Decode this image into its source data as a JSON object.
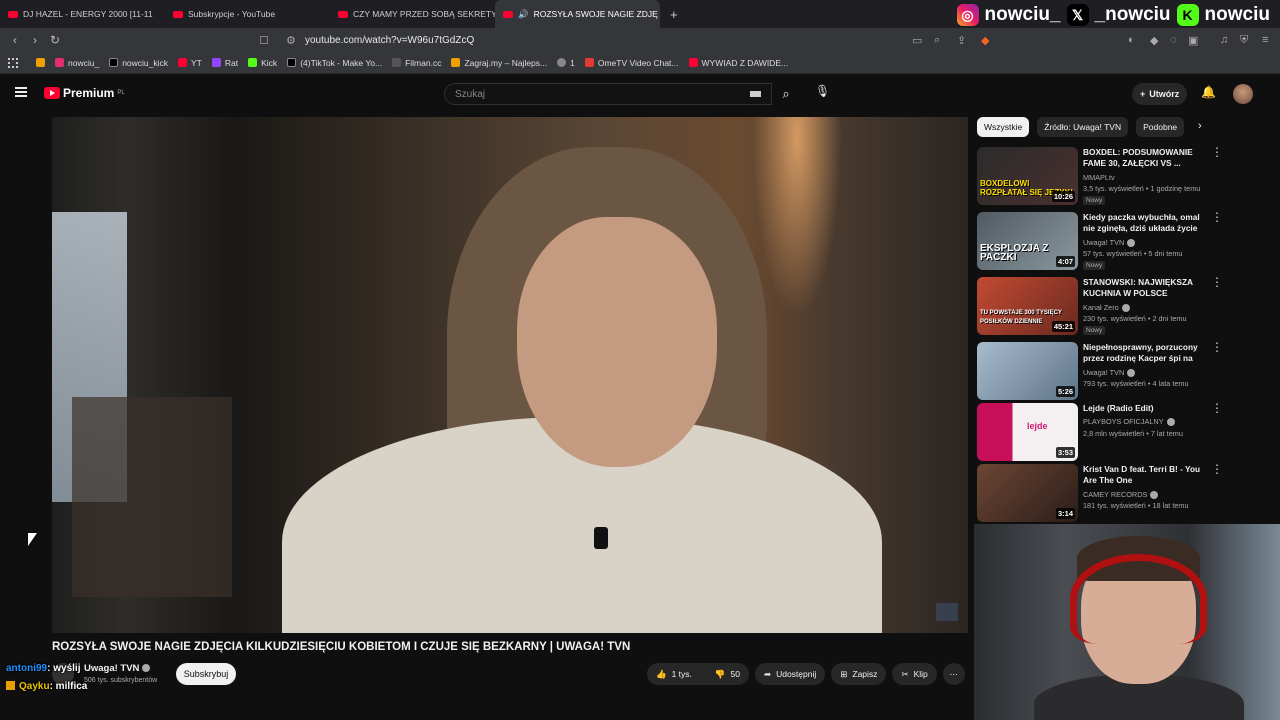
{
  "browser": {
    "tabs": [
      {
        "title": "DJ HAZEL - ENERGY 2000 [11-11"
      },
      {
        "title": "Subskrypcje - YouTube"
      },
      {
        "title": "CZY MAMY PRZED SOBĄ SEKRETY?"
      },
      {
        "title": "ROZSYŁA SWOJE NAGIE ZDJĘ",
        "active": true
      }
    ],
    "url": "youtube.com/watch?v=W96u7tGdZcQ",
    "bookmarks": [
      {
        "label": "nowciu_",
        "color": "#e1306c"
      },
      {
        "label": "nowciu_kick",
        "color": "#000000"
      },
      {
        "label": "YT",
        "color": "#ff0033"
      },
      {
        "label": "Rat",
        "color": "#9146ff"
      },
      {
        "label": "Kick",
        "color": "#53fc18"
      },
      {
        "label": "(4)TikTok - Make Yo...",
        "color": "#000000"
      },
      {
        "label": "Filman.cc",
        "color": "#555555"
      },
      {
        "label": "Zagraj.my – Najleps...",
        "color": "#f0a000"
      },
      {
        "label": "1",
        "color": "#888888"
      },
      {
        "label": "OmeTV Video Chat...",
        "color": "#e53935"
      },
      {
        "label": "WYWIAD Z DAWIDE...",
        "color": "#ff0033"
      }
    ]
  },
  "overlay": {
    "socials": [
      "nowciu_",
      "_nowciu",
      "nowciu"
    ],
    "chat": [
      {
        "user": "antoni99",
        "message": ": wyślij"
      },
      {
        "user": "Qayku",
        "message": ": milfica"
      }
    ]
  },
  "youtube": {
    "logo_text": "Premium",
    "logo_region": "PL",
    "search_placeholder": "Szukaj",
    "create_label": "Utwórz",
    "video": {
      "title": "ROZSYŁA SWOJE NAGIE ZDJĘCIA KILKUDZIESIĘCIU KOBIETOM I CZUJE SIĘ BEZKARNY | UWAGA! TVN",
      "channel": "Uwaga! TVN",
      "subscribers": "506 tys. subskrybentów",
      "subscribe_label": "Subskrybuj",
      "likes": "1 tys.",
      "dislikes": "50",
      "share_label": "Udostępnij",
      "save_label": "Zapisz",
      "clip_label": "Klip"
    },
    "chips": [
      "Wszystkie",
      "Źródło: Uwaga! TVN",
      "Podobne"
    ],
    "recommendations": [
      {
        "title": "BOXDEL: PODSUMOWANIE FAME 30, ZAŁĘCKI VS ...",
        "channel": "MMAPLtv",
        "meta": "3,5 tys. wyświetleń • 1 godzinę temu",
        "badge": "Nowy",
        "duration": "10:26",
        "thumb_text": "BOXDELOWI ROZPŁATAŁ SIĘ JĘZYK!",
        "thumb_color": "#3b2b2a"
      },
      {
        "title": "Kiedy paczka wybuchła, omal nie zginęła, dziś układa życie ...",
        "channel": "Uwaga! TVN",
        "meta": "57 tys. wyświetleń • 5 dni temu",
        "badge": "Nowy",
        "duration": "4:07",
        "thumb_text": "EKSPLOZJA Z PACZKI",
        "thumb_color": "#5a6670"
      },
      {
        "title": "STANOWSKI: NAJWIĘKSZA KUCHNIA W POLSCE",
        "channel": "Kanał Zero",
        "meta": "230 tys. wyświetleń • 2 dni temu",
        "badge": "Nowy",
        "duration": "45:21",
        "thumb_text": "TU POWSTAJE 300 TYSIĘCY POSIŁKÓW DZIENNIE",
        "thumb_color": "#b23a2a"
      },
      {
        "title": "Niepełnosprawny, porzucony przez rodzinę Kacper śpi na ...",
        "channel": "Uwaga! TVN",
        "meta": "793 tys. wyświetleń • 4 lata temu",
        "badge": "",
        "duration": "5:26",
        "thumb_text": "",
        "thumb_color": "#8aa3b8"
      },
      {
        "title": "Lejde (Radio Edit)",
        "channel": "PLAYBOYS OFICJALNY",
        "meta": "2,8 mln wyświetleń • 7 lat temu",
        "badge": "",
        "duration": "3:53",
        "thumb_text": "lejde",
        "thumb_color": "#d01870"
      },
      {
        "title": "Krist Van D feat. Terri B! - You Are The One",
        "channel": "CAMEY RECORDS",
        "meta": "181 tys. wyświetleń • 18 lat temu",
        "badge": "",
        "duration": "3:14",
        "thumb_text": "",
        "thumb_color": "#5a3a2c"
      }
    ]
  }
}
